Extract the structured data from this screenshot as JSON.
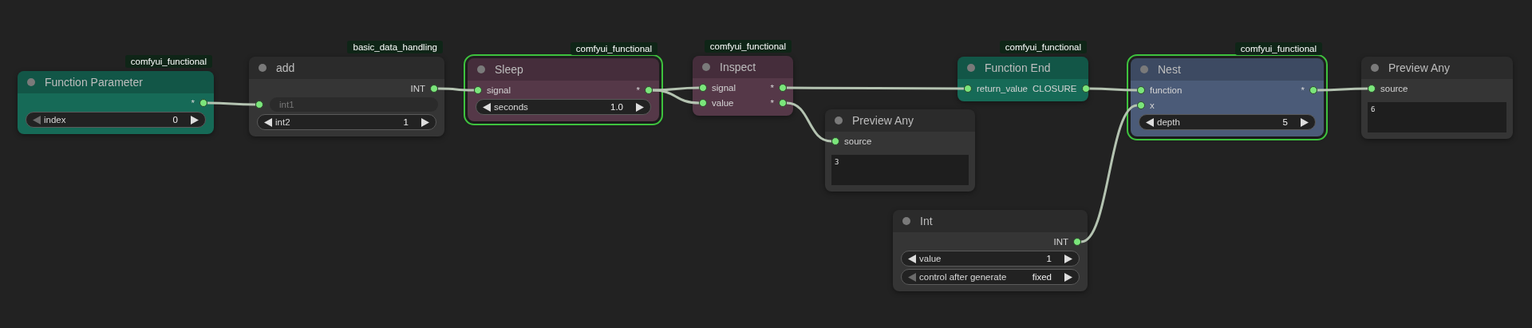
{
  "nodes": [
    {
      "title": "Function Parameter",
      "badge": "comfyui_functional",
      "color": "#166a57",
      "selected": false,
      "rows": [
        {
          "output": "*"
        }
      ],
      "widgets": [
        {
          "kind": "number",
          "label": "index",
          "value": "0",
          "decrement_disabled": true
        }
      ]
    },
    {
      "title": "add",
      "badge": "basic_data_handling",
      "color": "#353535",
      "selected": false,
      "rows": [
        {
          "output": "INT"
        }
      ],
      "widgets": [
        {
          "kind": "socket",
          "label": "int1"
        },
        {
          "kind": "number",
          "label": "int2",
          "value": "1",
          "decrement_disabled": false
        }
      ]
    },
    {
      "title": "Sleep",
      "badge": "comfyui_functional",
      "color": "#553848",
      "selected": true,
      "rows": [
        {
          "input": "signal",
          "output": "*"
        }
      ],
      "widgets": [
        {
          "kind": "number",
          "label": "seconds",
          "value": "1.0",
          "decrement_disabled": false
        }
      ]
    },
    {
      "title": "Inspect",
      "badge": "comfyui_functional",
      "color": "#553848",
      "selected": false,
      "rows": [
        {
          "input": "signal",
          "output": "*"
        },
        {
          "input": "value",
          "output": "*"
        }
      ]
    },
    {
      "title": "Preview Any",
      "color": "#353535",
      "selected": false,
      "rows": [
        {
          "input": "source"
        }
      ],
      "widgets": [
        {
          "kind": "text",
          "value": "3"
        }
      ]
    },
    {
      "title": "Function End",
      "badge": "comfyui_functional",
      "color": "#166a57",
      "selected": false,
      "rows": [
        {
          "input": "return_value",
          "output": "CLOSURE"
        }
      ]
    },
    {
      "title": "Nest",
      "badge": "comfyui_functional",
      "color": "#4b5b78",
      "selected": true,
      "rows": [
        {
          "input": "function",
          "output": "*"
        },
        {
          "input": "x"
        }
      ],
      "widgets": [
        {
          "kind": "number",
          "label": "depth",
          "value": "5",
          "decrement_disabled": false
        }
      ]
    },
    {
      "title": "Preview Any",
      "color": "#353535",
      "selected": false,
      "rows": [
        {
          "input": "source"
        }
      ],
      "widgets": [
        {
          "kind": "text",
          "value": "6"
        }
      ]
    },
    {
      "title": "Int",
      "color": "#353535",
      "selected": false,
      "rows": [
        {
          "output": "INT"
        }
      ],
      "widgets": [
        {
          "kind": "number",
          "label": "value",
          "value": "1",
          "decrement_disabled": false
        },
        {
          "kind": "combo",
          "label": "control after generate",
          "value": "fixed",
          "decrement_disabled": true
        }
      ]
    }
  ]
}
